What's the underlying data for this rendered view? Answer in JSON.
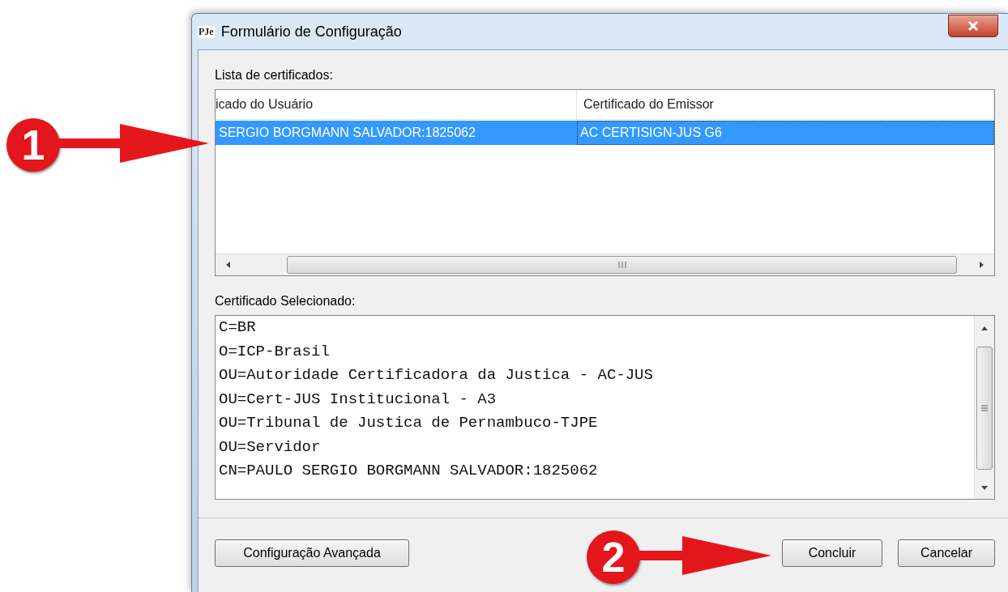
{
  "window": {
    "logo": "PJe",
    "title": "Formulário de Configuração"
  },
  "certificate_list": {
    "label": "Lista de certificados:",
    "columns": [
      "icado do Usuário",
      "Certificado do Emissor"
    ],
    "rows": [
      {
        "cells": [
          "SERGIO BORGMANN SALVADOR:1825062",
          "AC CERTISIGN-JUS G6"
        ],
        "selected": true
      }
    ]
  },
  "selected_certificate": {
    "label": "Certificado Selecionado:",
    "lines": [
      "C=BR",
      "O=ICP-Brasil",
      "OU=Autoridade Certificadora da Justica - AC-JUS",
      "OU=Cert-JUS Institucional - A3",
      "OU=Tribunal de Justica de Pernambuco-TJPE",
      "OU=Servidor",
      "CN=PAULO SERGIO BORGMANN SALVADOR:1825062"
    ]
  },
  "buttons": [
    {
      "label": "Configuração Avançada"
    },
    {
      "label": "Concluir"
    },
    {
      "label": "Cancelar"
    }
  ],
  "annotations": [
    {
      "number": "1"
    },
    {
      "number": "2"
    }
  ]
}
